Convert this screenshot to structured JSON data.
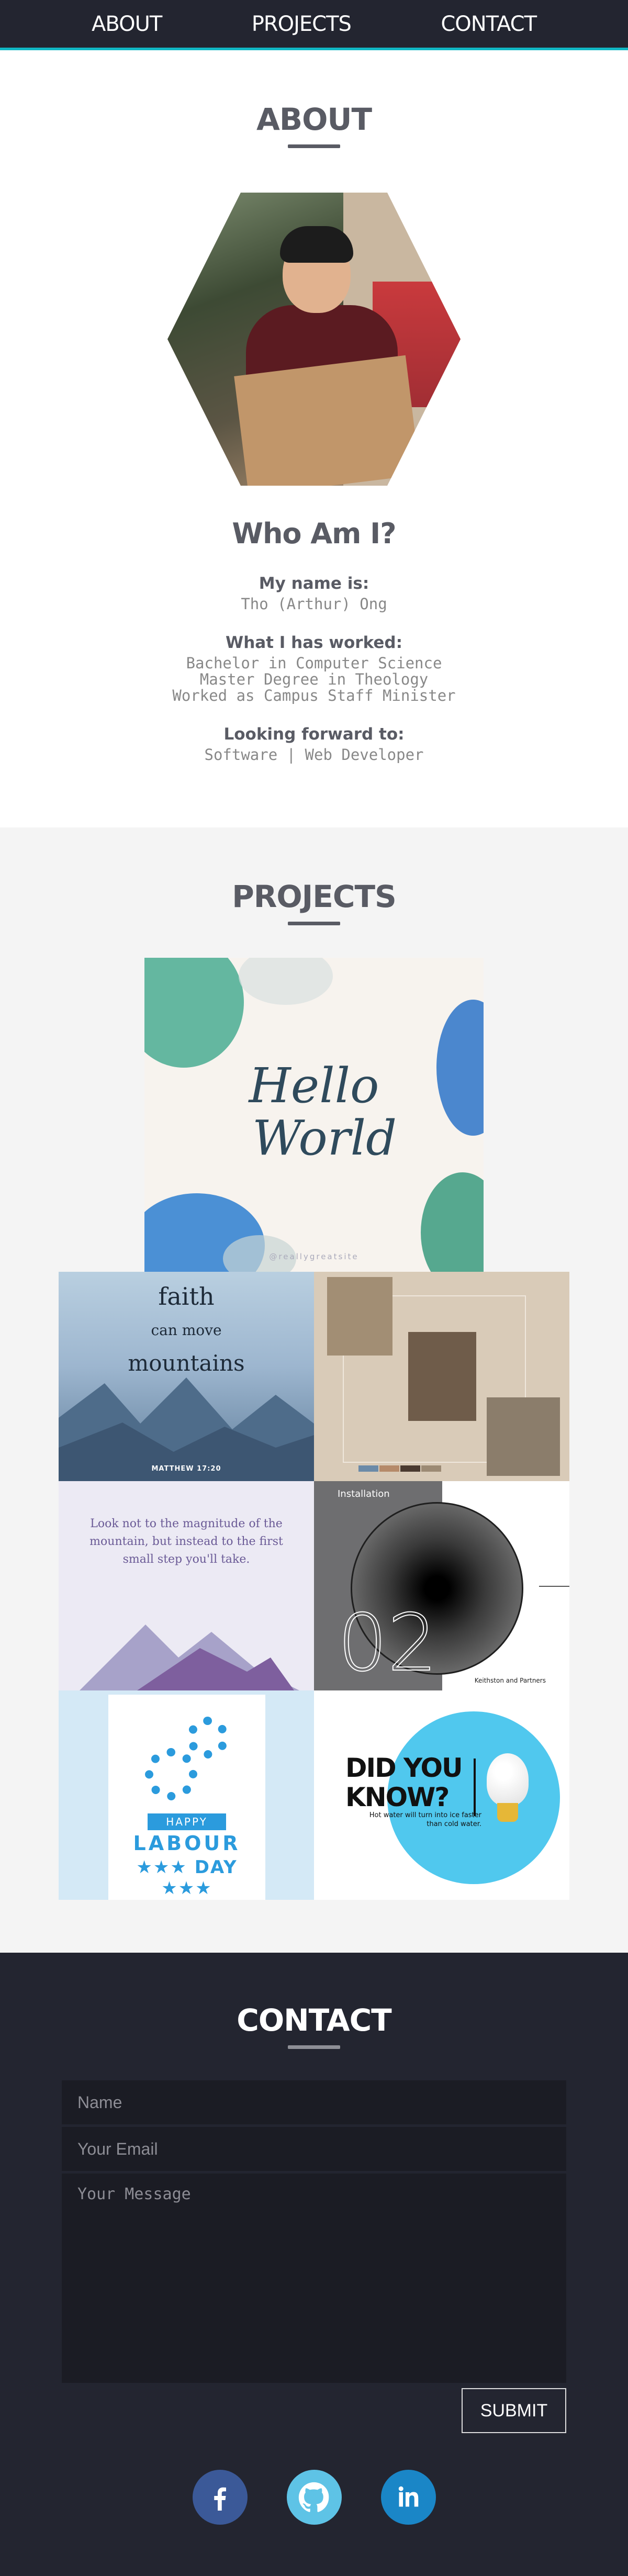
{
  "nav": {
    "about": "ABOUT",
    "projects": "PROJECTS",
    "contact": "CONTACT"
  },
  "about": {
    "title": "ABOUT",
    "heading": "Who Am I?",
    "name_label": "My name is:",
    "name_value": "Tho (Arthur) Ong",
    "worked_label": "What I has worked:",
    "worked": [
      "Bachelor in Computer Science",
      "Master Degree in Theology",
      "Worked as Campus Staff Minister"
    ],
    "forward_label": "Looking forward to:",
    "forward_value": "Software | Web Developer"
  },
  "projects": {
    "title": "PROJECTS",
    "hero": {
      "line1": "Hello",
      "line2": "World",
      "handle": "@reallygreatsite"
    },
    "faith": {
      "line1": "faith",
      "line2": "can move",
      "line3": "mountains",
      "verse": "MATTHEW 17:20"
    },
    "quote": {
      "text": "Look not to the magnitude of the mountain, but instead to the first small step you'll take."
    },
    "install": {
      "label": "Installation",
      "number": "02",
      "caption": "Keithston and Partners"
    },
    "labour": {
      "happy": "HAPPY",
      "labour": "LABOUR",
      "day": "DAY"
    },
    "dyk": {
      "title1": "DID YOU",
      "title2": "KNOW?",
      "text": "Hot water will turn into ice faster than cold water."
    }
  },
  "contact": {
    "title": "CONTACT",
    "name_placeholder": "Name",
    "email_placeholder": "Your Email",
    "message_placeholder": "Your Message",
    "submit": "SUBMIT",
    "socials": [
      "facebook-icon",
      "github-icon",
      "linkedin-icon"
    ]
  },
  "colors": {
    "nav_bg": "#232530",
    "accent": "#11b7c4",
    "heading": "#595b64",
    "projects_bg": "#f4f4f4"
  }
}
